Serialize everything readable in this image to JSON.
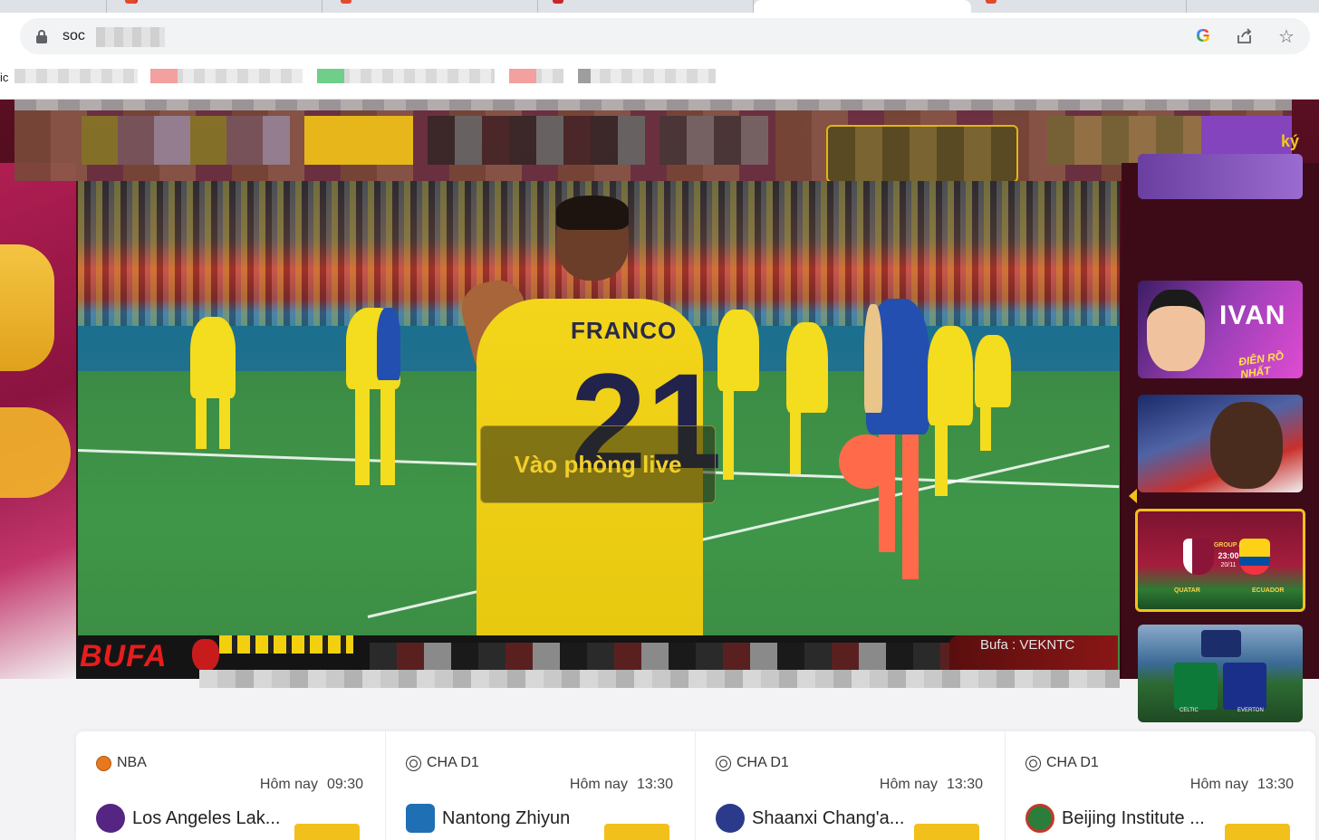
{
  "browser": {
    "url_prefix": "soc",
    "bookmarks_label": "ic"
  },
  "header": {
    "register_fragment": "ký"
  },
  "player": {
    "live_button_label": "Vào phòng live",
    "jersey_name": "FRANCO",
    "jersey_number": "21",
    "ticker_logo": "BUFA",
    "ticker_right_text": "Bufa : VEKNTC"
  },
  "sidebar": {
    "streamers": [
      {
        "title": "IVAN",
        "subtitle": "ĐIÊN RỒ NHẤT"
      },
      {
        "title": ""
      },
      {
        "group": "GROUP A",
        "time": "23:00",
        "date": "20/11",
        "home": "QUATAR",
        "away": "ECUADOR"
      },
      {
        "home": "CELTIC",
        "away": "EVERTON"
      }
    ]
  },
  "matches": [
    {
      "league": "NBA",
      "day": "Hôm nay",
      "time": "09:30",
      "team": "Los Angeles Lak...",
      "icon": "basketball-icon"
    },
    {
      "league": "CHA D1",
      "day": "Hôm nay",
      "time": "13:30",
      "team": "Nantong Zhiyun",
      "icon": "soccer-ball-icon"
    },
    {
      "league": "CHA D1",
      "day": "Hôm nay",
      "time": "13:30",
      "team": "Shaanxi Chang'a...",
      "icon": "soccer-ball-icon"
    },
    {
      "league": "CHA D1",
      "day": "Hôm nay",
      "time": "13:30",
      "team": "Beijing Institute ...",
      "icon": "soccer-ball-icon"
    }
  ],
  "colors": {
    "accent": "#f2c01a",
    "hero_bg": "#3e0a18",
    "ticker_red": "#e71d1d"
  }
}
